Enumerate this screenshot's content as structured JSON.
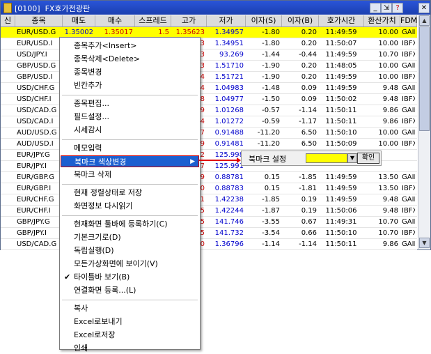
{
  "window": {
    "title": "[0100]  FX호가전광판",
    "buttons": {
      "minimize": "_",
      "restore": "⇲",
      "help": "?",
      "close": "✕"
    }
  },
  "grid": {
    "headers": [
      "신",
      "종목",
      "매도",
      "매수",
      "스프레드",
      "고가",
      "저가",
      "이자(S)",
      "이자(B)",
      "호가시간",
      "환산가치",
      "FDM"
    ],
    "rows": [
      {
        "symbol": "EUR/USD.G",
        "sell": "1.35002",
        "buy": "1.35017",
        "spread": "1.5",
        "high": "1.35623",
        "low": "1.34957",
        "int_s": "-1.80",
        "int_b": "0.20",
        "time": "11:49:59",
        "value": "10.00",
        "fdm": "GAIN"
      },
      {
        "symbol": "EUR/USD.I",
        "sell": "",
        "buy": "",
        "spread": "",
        "high": "3",
        "low": "1.34951",
        "int_s": "-1.80",
        "int_b": "0.20",
        "time": "11:50:07",
        "value": "10.00",
        "fdm": "IBFX"
      },
      {
        "symbol": "USD/JPY.I",
        "sell": "",
        "buy": "",
        "spread": "",
        "high": "3",
        "low": "93.269",
        "int_s": "-1.44",
        "int_b": "-0.44",
        "time": "11:49:59",
        "value": "10.70",
        "fdm": "IBFX"
      },
      {
        "symbol": "GBP/USD.G",
        "sell": "",
        "buy": "",
        "spread": "",
        "high": "3",
        "low": "1.51710",
        "int_s": "-1.90",
        "int_b": "0.20",
        "time": "11:48:05",
        "value": "10.00",
        "fdm": "GAIN"
      },
      {
        "symbol": "GBP/USD.I",
        "sell": "",
        "buy": "",
        "spread": "",
        "high": "4",
        "low": "1.51721",
        "int_s": "-1.90",
        "int_b": "0.20",
        "time": "11:49:59",
        "value": "10.00",
        "fdm": "IBFX"
      },
      {
        "symbol": "USD/CHF.G",
        "sell": "",
        "buy": "",
        "spread": "",
        "high": "4",
        "low": "1.04983",
        "int_s": "-1.48",
        "int_b": "0.09",
        "time": "11:49:59",
        "value": "9.48",
        "fdm": "GAIN"
      },
      {
        "symbol": "USD/CHF.I",
        "sell": "",
        "buy": "",
        "spread": "",
        "high": "8",
        "low": "1.04977",
        "int_s": "-1.50",
        "int_b": "0.09",
        "time": "11:50:02",
        "value": "9.48",
        "fdm": "IBFX"
      },
      {
        "symbol": "USD/CAD.G",
        "sell": "",
        "buy": "",
        "spread": "",
        "high": "9",
        "low": "1.01268",
        "int_s": "-0.57",
        "int_b": "-1.14",
        "time": "11:50:11",
        "value": "9.86",
        "fdm": "GAIN"
      },
      {
        "symbol": "USD/CAD.I",
        "sell": "",
        "buy": "",
        "spread": "",
        "high": "4",
        "low": "1.01272",
        "int_s": "-0.59",
        "int_b": "-1.17",
        "time": "11:50:11",
        "value": "9.86",
        "fdm": "IBFX"
      },
      {
        "symbol": "AUD/USD.G",
        "sell": "",
        "buy": "",
        "spread": "",
        "high": "7",
        "low": "0.91488",
        "int_s": "-11.20",
        "int_b": "6.50",
        "time": "11:50:10",
        "value": "10.00",
        "fdm": "GAIN"
      },
      {
        "symbol": "AUD/USD.I",
        "sell": "",
        "buy": "",
        "spread": "",
        "high": "9",
        "low": "0.91481",
        "int_s": "-11.20",
        "int_b": "6.50",
        "time": "11:50:09",
        "value": "10.00",
        "fdm": "IBFX"
      },
      {
        "symbol": "EUR/JPY.G",
        "sell": "",
        "buy": "",
        "spread": "",
        "high": "2",
        "low": "125.998",
        "int_s": "",
        "int_b": "",
        "time": "",
        "value": "",
        "fdm": ""
      },
      {
        "symbol": "EUR/JPY.I",
        "sell": "",
        "buy": "",
        "spread": "",
        "high": "7",
        "low": "125.991",
        "int_s": "",
        "int_b": "",
        "time": "",
        "value": "",
        "fdm": ""
      },
      {
        "symbol": "EUR/GBP.G",
        "sell": "",
        "buy": "",
        "spread": "",
        "high": "9",
        "low": "0.88781",
        "int_s": "0.15",
        "int_b": "-1.85",
        "time": "11:49:59",
        "value": "13.50",
        "fdm": "GAIN"
      },
      {
        "symbol": "EUR/GBP.I",
        "sell": "",
        "buy": "",
        "spread": "",
        "high": "0",
        "low": "0.88783",
        "int_s": "0.15",
        "int_b": "-1.81",
        "time": "11:49:59",
        "value": "13.50",
        "fdm": "IBFX"
      },
      {
        "symbol": "EUR/CHF.G",
        "sell": "",
        "buy": "",
        "spread": "",
        "high": "1",
        "low": "1.42238",
        "int_s": "-1.85",
        "int_b": "0.19",
        "time": "11:49:59",
        "value": "9.48",
        "fdm": "GAIN"
      },
      {
        "symbol": "EUR/CHF.I",
        "sell": "",
        "buy": "",
        "spread": "",
        "high": "5",
        "low": "1.42244",
        "int_s": "-1.87",
        "int_b": "0.19",
        "time": "11:50:06",
        "value": "9.48",
        "fdm": "IBFX"
      },
      {
        "symbol": "GBP/JPY.G",
        "sell": "",
        "buy": "",
        "spread": "",
        "high": "5",
        "low": "141.746",
        "int_s": "-3.55",
        "int_b": "0.67",
        "time": "11:49:31",
        "value": "10.70",
        "fdm": "GAIN"
      },
      {
        "symbol": "GBP/JPY.I",
        "sell": "",
        "buy": "",
        "spread": "",
        "high": "5",
        "low": "141.732",
        "int_s": "-3.54",
        "int_b": "0.66",
        "time": "11:50:10",
        "value": "10.70",
        "fdm": "IBFX"
      },
      {
        "symbol": "USD/CAD.G",
        "sell": "",
        "buy": "",
        "spread": "",
        "high": "0",
        "low": "1.36796",
        "int_s": "-1.14",
        "int_b": "-1.14",
        "time": "11:50:11",
        "value": "9.86",
        "fdm": "GAIN"
      }
    ]
  },
  "context_menu": {
    "items": [
      {
        "label": "종목추가<Insert>",
        "sep_before": false
      },
      {
        "label": "종목삭제<Delete>",
        "sep_before": false
      },
      {
        "label": "종목변경",
        "sep_before": false
      },
      {
        "label": "빈칸추가",
        "sep_before": false
      },
      {
        "label": "종목편집...",
        "sep_before": true
      },
      {
        "label": "필드설정...",
        "sep_before": false
      },
      {
        "label": "시세감시",
        "sep_before": false
      },
      {
        "label": "메모입력",
        "sep_before": true
      },
      {
        "label": "북마크 색상변경",
        "sep_before": false,
        "selected": true,
        "submenu": true
      },
      {
        "label": "북마크 삭제",
        "sep_before": false
      },
      {
        "label": "현재 정렬상태로 저장",
        "sep_before": true
      },
      {
        "label": "화면정보 다시읽기",
        "sep_before": false
      },
      {
        "label": "현재화면 툴바에 등록하기(C)",
        "sep_before": true
      },
      {
        "label": "기본크기로(D)",
        "sep_before": false
      },
      {
        "label": "독립실행(D)",
        "sep_before": false
      },
      {
        "label": "모든가상화면에 보이기(V)",
        "sep_before": false
      },
      {
        "label": "타이틀바 보기(B)",
        "sep_before": false,
        "checked": true
      },
      {
        "label": "연결화면 등록...(L)",
        "sep_before": false
      },
      {
        "label": "복사",
        "sep_before": true
      },
      {
        "label": "Excel로보내기",
        "sep_before": false
      },
      {
        "label": "Excel로저장",
        "sep_before": false
      },
      {
        "label": "인쇄",
        "sep_before": false
      }
    ]
  },
  "submenu": {
    "label": "북마크 설정",
    "selected_color": "#ffff00",
    "confirm_label": "확인"
  },
  "colors": {
    "selected_row": "#ffff00",
    "sell_color": "#0000cc",
    "buy_color": "#cc0000",
    "menu_highlight": "#1c5fd0"
  }
}
